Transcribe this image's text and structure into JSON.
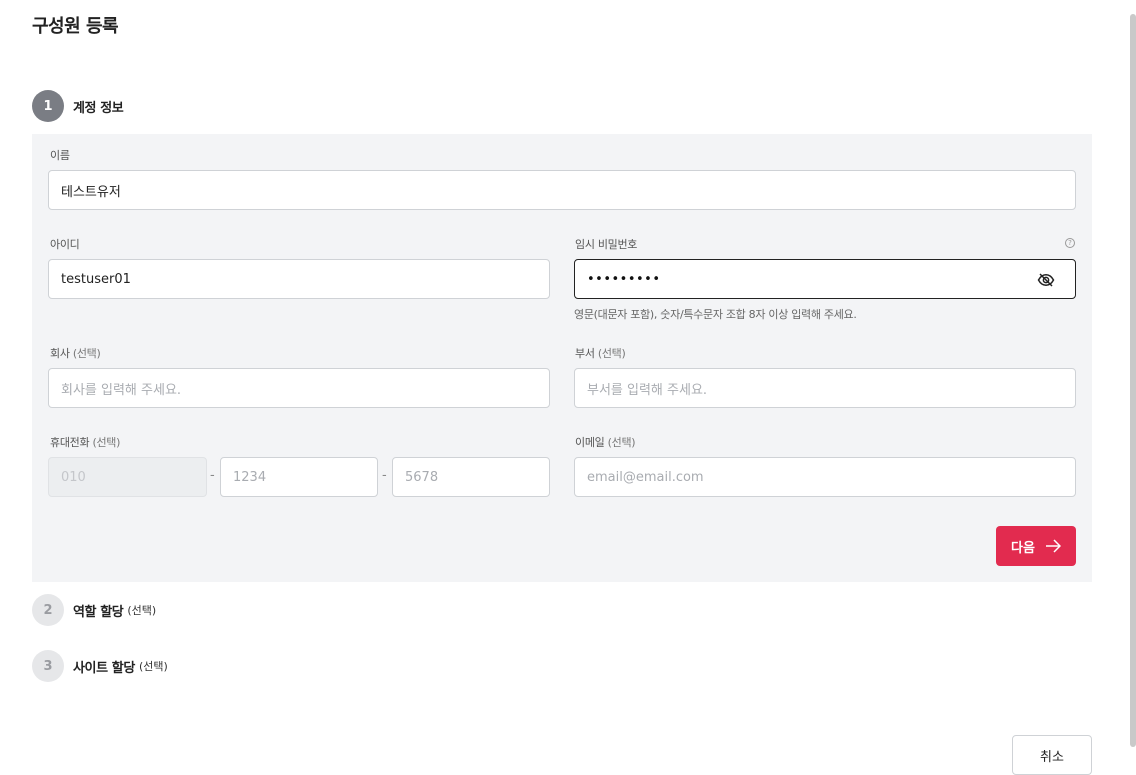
{
  "modal": {
    "title": "구성원 등록"
  },
  "steps": [
    {
      "number": "1",
      "label": "계정 정보",
      "optional": ""
    },
    {
      "number": "2",
      "label": "역할 할당",
      "optional": "(선택)"
    },
    {
      "number": "3",
      "label": "사이트 할당",
      "optional": "(선택)"
    }
  ],
  "form": {
    "name": {
      "label": "이름",
      "value": "테스트유저"
    },
    "user_id": {
      "label": "아이디",
      "value": "testuser01"
    },
    "temp_password": {
      "label": "임시 비밀번호",
      "value_masked": "•••••••••",
      "hint": "영문(대문자 포함), 숫자/특수문자 조합 8자 이상 입력해 주세요."
    },
    "company": {
      "label": "회사",
      "optional": "(선택)",
      "placeholder": "회사를 입력해 주세요."
    },
    "department": {
      "label": "부서",
      "optional": "(선택)",
      "placeholder": "부서를 입력해 주세요."
    },
    "phone": {
      "label": "휴대전화",
      "optional": "(선택)",
      "part1": "010",
      "part2_placeholder": "1234",
      "part3_placeholder": "5678",
      "separator": "-"
    },
    "email": {
      "label": "이메일",
      "optional": "(선택)",
      "placeholder": "email@email.com"
    }
  },
  "buttons": {
    "next_label": "다음",
    "cancel_label": "취소"
  },
  "colors": {
    "accent": "#e22b4f",
    "panel_bg": "#f3f4f6",
    "active_step": "#7a7d84"
  },
  "icons": {
    "password_toggle": "eye-off-icon",
    "help": "question-circle-icon",
    "next_arrow": "arrow-right-icon"
  }
}
